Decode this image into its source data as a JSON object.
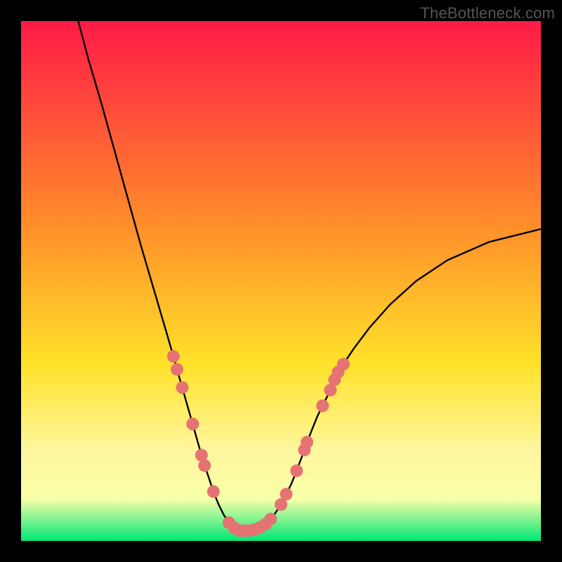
{
  "watermark": "TheBottleneck.com",
  "colors": {
    "frame": "#000000",
    "gradient_top": "#ff1a47",
    "gradient_mid1": "#ff8a2a",
    "gradient_mid2": "#ffe22a",
    "gradient_low": "#fff7a0",
    "gradient_band": "#f7ffa8",
    "gradient_bottom": "#00e676",
    "curve": "#000000",
    "marker_fill": "#e57373",
    "marker_stroke": "#d35b5b"
  },
  "chart_data": {
    "type": "line",
    "title": "",
    "xlabel": "",
    "ylabel": "",
    "xlim": [
      0,
      100
    ],
    "ylim": [
      0,
      100
    ],
    "curve": {
      "type": "v_curve",
      "min_x": 42,
      "min_y": 2,
      "left_start": {
        "x": 11,
        "y": 100
      },
      "right_end": {
        "x": 100,
        "y": 60
      },
      "points": [
        {
          "x": 11.0,
          "y": 100.0
        },
        {
          "x": 13.0,
          "y": 92.5
        },
        {
          "x": 15.5,
          "y": 84.0
        },
        {
          "x": 18.0,
          "y": 75.0
        },
        {
          "x": 20.5,
          "y": 66.0
        },
        {
          "x": 23.0,
          "y": 57.0
        },
        {
          "x": 25.5,
          "y": 48.5
        },
        {
          "x": 28.0,
          "y": 40.0
        },
        {
          "x": 29.3,
          "y": 35.5
        },
        {
          "x": 30.0,
          "y": 33.0
        },
        {
          "x": 31.0,
          "y": 29.5
        },
        {
          "x": 32.0,
          "y": 26.0
        },
        {
          "x": 33.0,
          "y": 22.5
        },
        {
          "x": 34.0,
          "y": 19.0
        },
        {
          "x": 34.7,
          "y": 16.5
        },
        {
          "x": 35.3,
          "y": 14.5
        },
        {
          "x": 36.0,
          "y": 12.5
        },
        {
          "x": 37.0,
          "y": 9.5
        },
        {
          "x": 38.0,
          "y": 7.0
        },
        {
          "x": 39.0,
          "y": 5.0
        },
        {
          "x": 40.0,
          "y": 3.5
        },
        {
          "x": 41.0,
          "y": 2.5
        },
        {
          "x": 42.0,
          "y": 2.0
        },
        {
          "x": 43.0,
          "y": 2.0
        },
        {
          "x": 44.0,
          "y": 2.0
        },
        {
          "x": 45.0,
          "y": 2.2
        },
        {
          "x": 46.0,
          "y": 2.6
        },
        {
          "x": 47.0,
          "y": 3.2
        },
        {
          "x": 48.0,
          "y": 4.2
        },
        {
          "x": 49.0,
          "y": 5.5
        },
        {
          "x": 50.0,
          "y": 7.0
        },
        {
          "x": 51.0,
          "y": 9.0
        },
        {
          "x": 52.0,
          "y": 11.0
        },
        {
          "x": 53.0,
          "y": 13.5
        },
        {
          "x": 54.5,
          "y": 17.5
        },
        {
          "x": 55.0,
          "y": 19.0
        },
        {
          "x": 56.0,
          "y": 21.5
        },
        {
          "x": 57.0,
          "y": 24.0
        },
        {
          "x": 58.0,
          "y": 26.0
        },
        {
          "x": 59.5,
          "y": 29.0
        },
        {
          "x": 60.3,
          "y": 31.0
        },
        {
          "x": 61.0,
          "y": 32.5
        },
        {
          "x": 62.0,
          "y": 34.0
        },
        {
          "x": 64.0,
          "y": 37.0
        },
        {
          "x": 67.0,
          "y": 41.0
        },
        {
          "x": 71.0,
          "y": 45.5
        },
        {
          "x": 76.0,
          "y": 50.0
        },
        {
          "x": 82.0,
          "y": 54.0
        },
        {
          "x": 90.0,
          "y": 57.5
        },
        {
          "x": 100.0,
          "y": 60.0
        }
      ]
    },
    "markers": [
      {
        "x": 29.3,
        "y": 35.5
      },
      {
        "x": 30.0,
        "y": 33.0
      },
      {
        "x": 31.0,
        "y": 29.5
      },
      {
        "x": 33.0,
        "y": 22.5
      },
      {
        "x": 34.7,
        "y": 16.5
      },
      {
        "x": 35.3,
        "y": 14.5
      },
      {
        "x": 37.0,
        "y": 9.5
      },
      {
        "x": 40.0,
        "y": 3.5
      },
      {
        "x": 41.0,
        "y": 2.5
      },
      {
        "x": 42.0,
        "y": 2.0
      },
      {
        "x": 43.0,
        "y": 2.0
      },
      {
        "x": 44.0,
        "y": 2.0
      },
      {
        "x": 45.0,
        "y": 2.2
      },
      {
        "x": 46.0,
        "y": 2.6
      },
      {
        "x": 47.0,
        "y": 3.2
      },
      {
        "x": 48.0,
        "y": 4.2
      },
      {
        "x": 50.0,
        "y": 7.0
      },
      {
        "x": 51.0,
        "y": 9.0
      },
      {
        "x": 53.0,
        "y": 13.5
      },
      {
        "x": 54.5,
        "y": 17.5
      },
      {
        "x": 55.0,
        "y": 19.0
      },
      {
        "x": 58.0,
        "y": 26.0
      },
      {
        "x": 59.5,
        "y": 29.0
      },
      {
        "x": 60.3,
        "y": 31.0
      },
      {
        "x": 61.0,
        "y": 32.5
      },
      {
        "x": 62.0,
        "y": 34.0
      }
    ]
  }
}
